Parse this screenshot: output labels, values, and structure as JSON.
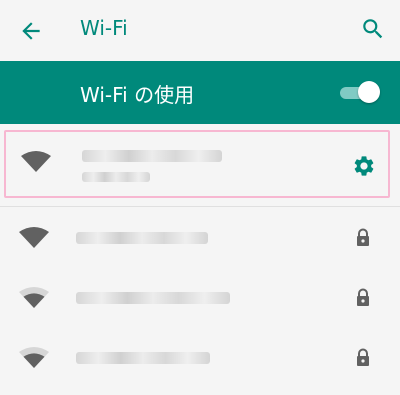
{
  "header": {
    "back_icon": "back-arrow-icon",
    "title": "Wi-Fi",
    "search_icon": "search-icon"
  },
  "banner": {
    "label": "Wi-Fi の使用",
    "toggle_state": "on"
  },
  "networks": [
    {
      "ssid": "",
      "status": "",
      "signal": "full",
      "icon": "wifi-full-icon",
      "action_icon": "gear-icon",
      "selected": true
    },
    {
      "ssid": "",
      "signal": "full",
      "icon": "wifi-full-icon",
      "secure_icon": "lock-icon"
    },
    {
      "ssid": "",
      "signal": "medium",
      "icon": "wifi-medium-icon",
      "secure_icon": "lock-icon"
    },
    {
      "ssid": "",
      "signal": "medium",
      "icon": "wifi-medium-icon",
      "secure_icon": "lock-icon"
    }
  ],
  "colors": {
    "accent": "#00897b",
    "selection_border": "#f7b7d1",
    "icon_gray": "#616161"
  }
}
